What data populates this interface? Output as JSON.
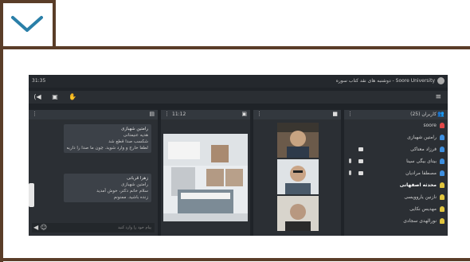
{
  "header": {
    "collapse_icon": "chevron-down-icon",
    "frame_color": "#5a3d28"
  },
  "app": {
    "clock": "31:35",
    "title": "Soore University - دوشنبه های نقد کتاب سوره",
    "toolbar": {
      "icons": [
        "speaker-icon",
        "screen-share-icon",
        "raise-hand-icon"
      ],
      "menu_icon": "hamburger-icon"
    }
  },
  "users_panel": {
    "title": "کاربران (25)",
    "users": [
      {
        "name": "soore",
        "color": "#e04848",
        "bold": false,
        "cam": false,
        "mic": false
      },
      {
        "name": "رامتین شهبازی",
        "color": "#3d8fe0",
        "bold": false,
        "cam": false,
        "mic": false
      },
      {
        "name": "فرزاد معتاکی",
        "color": "#3d8fe0",
        "bold": false,
        "cam": true,
        "mic": false
      },
      {
        "name": "بیتای بیگی سینا",
        "color": "#3d8fe0",
        "bold": false,
        "cam": true,
        "mic": true
      },
      {
        "name": "مصطفا مرادیان",
        "color": "#3d8fe0",
        "bold": false,
        "cam": true,
        "mic": true
      },
      {
        "name": "محدثه اصفهانی",
        "color": "#e0c43d",
        "bold": true,
        "cam": false,
        "mic": false
      },
      {
        "name": "نازنین یاروویسی",
        "color": "#e0c43d",
        "bold": false,
        "cam": false,
        "mic": false
      },
      {
        "name": "مهدیس نکایی",
        "color": "#e0c43d",
        "bold": false,
        "cam": false,
        "mic": false
      },
      {
        "name": "نورالهدی سجادی",
        "color": "#e0c43d",
        "bold": false,
        "cam": false,
        "mic": false
      }
    ]
  },
  "presentation_panel": {
    "page": "11:12"
  },
  "chat_panel": {
    "messages": [
      {
        "name": "رامتین شهبازی",
        "lines": [
          "هدیه عنیمتانی",
          "شکسب صدا قطع شد",
          "لطفا خارج و وارد شوید. چون ما صدا را داریم"
        ]
      },
      {
        "name": "زهرا قربانی",
        "lines": [
          "رامتین شهبازی",
          "سلام خانم دکتر، خوش آمدید",
          "زنده باشید. ممنونم"
        ]
      }
    ],
    "input_placeholder": "پیام خود را وارد کنید"
  }
}
